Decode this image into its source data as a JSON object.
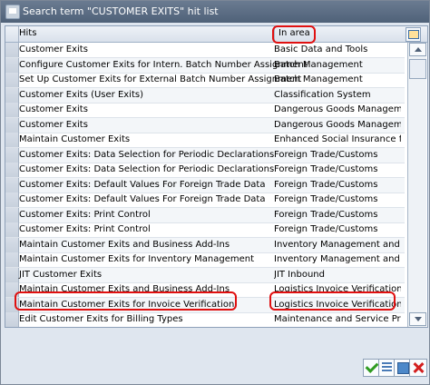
{
  "window": {
    "title": "Search term \"CUSTOMER EXITS\" hit list"
  },
  "table": {
    "columns": [
      "Hits",
      "In area"
    ],
    "rows": [
      {
        "hits": "Customer Exits",
        "area": "Basic Data and Tools"
      },
      {
        "hits": "Configure Customer Exits for Intern. Batch Number Assignment",
        "area": "Batch Management"
      },
      {
        "hits": "Set Up Customer Exits for External Batch Number Assignment",
        "area": "Batch Management"
      },
      {
        "hits": "Customer Exits (User Exits)",
        "area": "Classification System"
      },
      {
        "hits": "Customer Exits",
        "area": "Dangerous Goods Management"
      },
      {
        "hits": "Customer Exits",
        "area": "Dangerous Goods Management"
      },
      {
        "hits": "Maintain Customer Exits",
        "area": "Enhanced Social Insurance for Pub"
      },
      {
        "hits": "Customer Exits: Data Selection for Periodic Declarations",
        "area": "Foreign Trade/Customs"
      },
      {
        "hits": "Customer Exits: Data Selection for Periodic Declarations",
        "area": "Foreign Trade/Customs"
      },
      {
        "hits": "Customer Exits: Default Values For Foreign Trade Data",
        "area": "Foreign Trade/Customs"
      },
      {
        "hits": "Customer Exits: Default Values For Foreign Trade Data",
        "area": "Foreign Trade/Customs"
      },
      {
        "hits": "Customer Exits: Print Control",
        "area": "Foreign Trade/Customs"
      },
      {
        "hits": "Customer Exits: Print Control",
        "area": "Foreign Trade/Customs"
      },
      {
        "hits": "Maintain Customer Exits and Business Add-Ins",
        "area": "Inventory Management and Physic"
      },
      {
        "hits": "Maintain Customer Exits for Inventory Management",
        "area": "Inventory Management and Physic"
      },
      {
        "hits": "JIT Customer Exits",
        "area": "JIT Inbound"
      },
      {
        "hits": "Maintain Customer Exits and Business Add-Ins",
        "area": "Logistics Invoice Verification"
      },
      {
        "hits": "Maintain Customer Exits for Invoice Verification",
        "area": "Logistics Invoice Verification"
      },
      {
        "hits": "Edit Customer Exits for Billing Types",
        "area": "Maintenance and Service Processin"
      }
    ]
  },
  "icons": {
    "column_settings": "table-settings-icon",
    "ok": "checkmark-icon",
    "select": "list-select-icon",
    "copy": "copy-icon",
    "cancel": "cancel-icon"
  }
}
